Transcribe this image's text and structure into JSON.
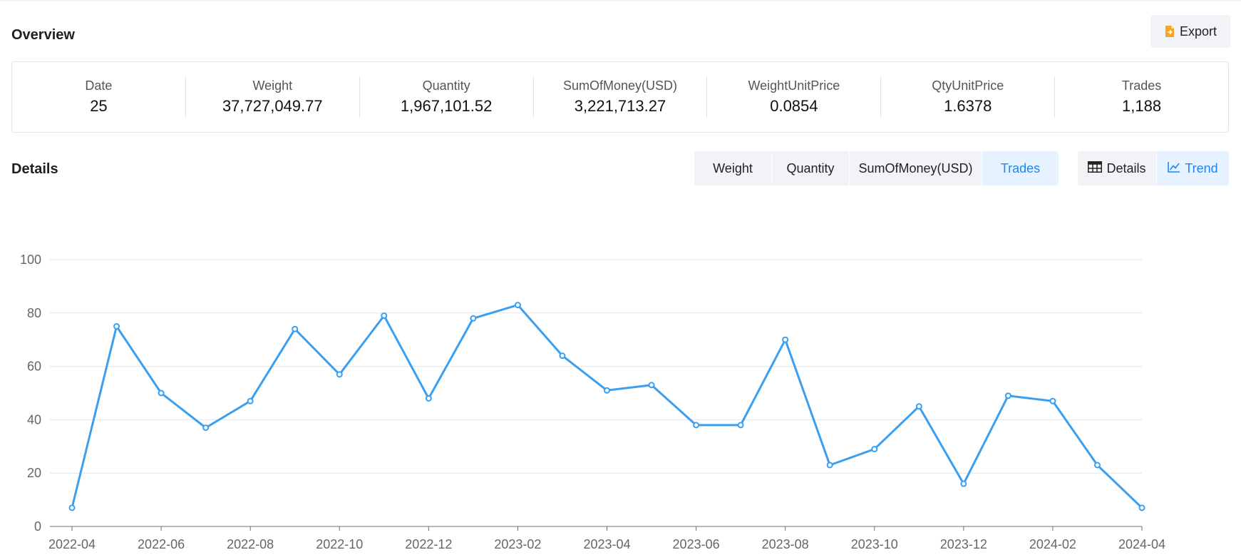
{
  "overview": {
    "title": "Overview",
    "export_label": "Export",
    "stats": [
      {
        "label": "Date",
        "value": "25"
      },
      {
        "label": "Weight",
        "value": "37,727,049.77"
      },
      {
        "label": "Quantity",
        "value": "1,967,101.52"
      },
      {
        "label": "SumOfMoney(USD)",
        "value": "3,221,713.27"
      },
      {
        "label": "WeightUnitPrice",
        "value": "0.0854"
      },
      {
        "label": "QtyUnitPrice",
        "value": "1.6378"
      },
      {
        "label": "Trades",
        "value": "1,188"
      }
    ]
  },
  "details": {
    "title": "Details",
    "metric_tabs": [
      {
        "label": "Weight",
        "active": false
      },
      {
        "label": "Quantity",
        "active": false
      },
      {
        "label": "SumOfMoney(USD)",
        "active": false
      },
      {
        "label": "Trades",
        "active": true
      }
    ],
    "view_tabs": [
      {
        "label": "Details",
        "icon": "table-icon",
        "active": false
      },
      {
        "label": "Trend",
        "icon": "line-chart-icon",
        "active": true
      }
    ]
  },
  "colors": {
    "accent": "#1f86f2",
    "line": "#3a9ff0",
    "export_icon": "#f5a623"
  },
  "chart_data": {
    "type": "line",
    "x": [
      "2022-04",
      "2022-05",
      "2022-06",
      "2022-07",
      "2022-08",
      "2022-09",
      "2022-10",
      "2022-11",
      "2022-12",
      "2023-01",
      "2023-02",
      "2023-03",
      "2023-04",
      "2023-05",
      "2023-06",
      "2023-07",
      "2023-08",
      "2023-09",
      "2023-10",
      "2023-11",
      "2023-12",
      "2024-01",
      "2024-02",
      "2024-03",
      "2024-04"
    ],
    "x_tick_labels": [
      "2022-04",
      "2022-06",
      "2022-08",
      "2022-10",
      "2022-12",
      "2023-02",
      "2023-04",
      "2023-06",
      "2023-08",
      "2023-10",
      "2023-12",
      "2024-02",
      "2024-04"
    ],
    "series": [
      {
        "values": [
          7,
          75,
          50,
          37,
          47,
          74,
          57,
          79,
          48,
          78,
          83,
          64,
          51,
          53,
          38,
          38,
          70,
          23,
          29,
          45,
          16,
          49,
          47,
          23,
          7
        ]
      }
    ],
    "ylim": [
      0,
      100
    ],
    "y_ticks": [
      0,
      20,
      40,
      60,
      80,
      100
    ],
    "grid": true
  }
}
